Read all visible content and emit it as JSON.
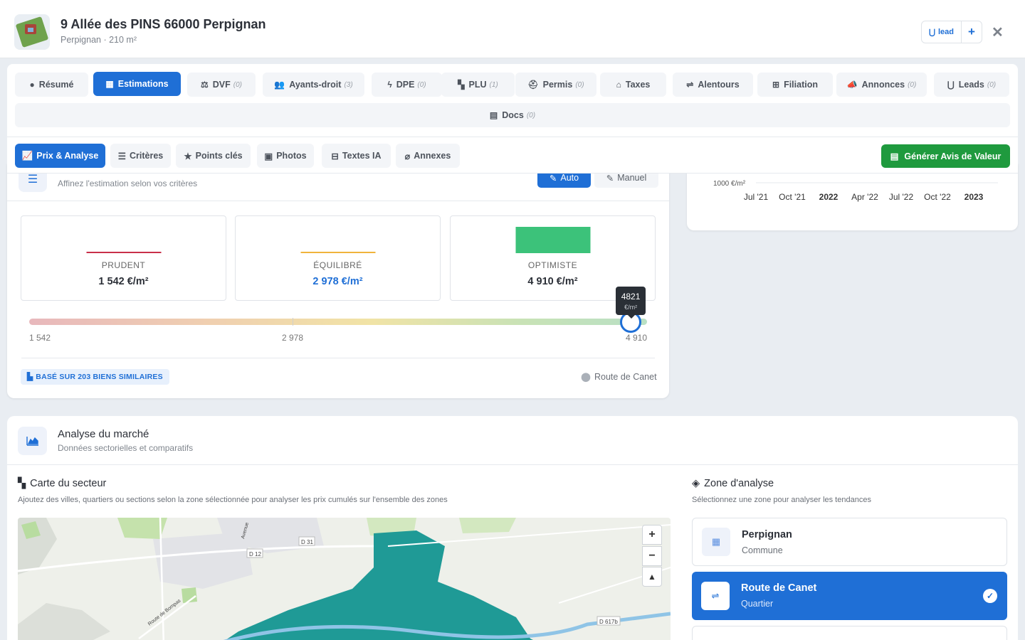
{
  "header": {
    "title": "9 Allée des PINS 66000 Perpignan",
    "subtitle": "Perpignan · 210 m²",
    "lead_label": "lead",
    "add_label": "+",
    "close_label": "✕"
  },
  "tabs": [
    {
      "label": "Résumé",
      "count": "",
      "icon": "info-circle"
    },
    {
      "label": "Estimations",
      "count": "",
      "icon": "calculator"
    },
    {
      "label": "DVF",
      "count": "(0)",
      "icon": "scale"
    },
    {
      "label": "Ayants-droit",
      "count": "(3)",
      "icon": "users"
    },
    {
      "label": "DPE",
      "count": "(0)",
      "icon": "bolt"
    },
    {
      "label": "PLU",
      "count": "(1)",
      "icon": "map-marked"
    },
    {
      "label": "Permis",
      "count": "(0)",
      "icon": "hard-hat"
    },
    {
      "label": "Taxes",
      "count": "",
      "icon": "landmark"
    },
    {
      "label": "Alentours",
      "count": "",
      "icon": "signs"
    },
    {
      "label": "Filiation",
      "count": "",
      "icon": "sitemap"
    },
    {
      "label": "Annonces",
      "count": "(0)",
      "icon": "bullhorn"
    },
    {
      "label": "Leads",
      "count": "(0)",
      "icon": "magnet"
    },
    {
      "label": "Docs",
      "count": "(0)",
      "icon": "file"
    }
  ],
  "active_tab": "Estimations",
  "subtabs": [
    {
      "label": "Prix & Analyse",
      "icon": "chart-line"
    },
    {
      "label": "Critères",
      "icon": "sliders"
    },
    {
      "label": "Points clés",
      "icon": "star"
    },
    {
      "label": "Photos",
      "icon": "images"
    },
    {
      "label": "Textes IA",
      "icon": "robot"
    },
    {
      "label": "Annexes",
      "icon": "paperclip"
    }
  ],
  "active_subtab": "Prix & Analyse",
  "generate_button": "Générer Avis de Valeur",
  "adjust": {
    "subtitle": "Affinez l'estimation selon vos critères",
    "mode_auto": "Auto",
    "mode_manual": "Manuel"
  },
  "scenarios": [
    {
      "label": "PRUDENT",
      "value": "1 542 €/m²",
      "color": "#c9304a"
    },
    {
      "label": "ÉQUILIBRÉ",
      "value": "2 978 €/m²",
      "color": "#f0b43c"
    },
    {
      "label": "OPTIMISTE",
      "value": "4 910 €/m²",
      "color": "#3cc27a"
    }
  ],
  "slider": {
    "min_label": "1 542",
    "mid_label": "2 978",
    "max_label": "4 910",
    "min": 1542,
    "max": 4910,
    "value": 4821,
    "tooltip_value": "4821",
    "tooltip_unit": "€/m²"
  },
  "based_on": "BASÉ SUR 203 BIENS SIMILAIRES",
  "location": "Route de Canet",
  "mini_chart": {
    "y_label": "1000 €/m²",
    "x_labels": [
      "Jul '21",
      "Oct '21",
      "2022",
      "Apr '22",
      "Jul '22",
      "Oct '22",
      "2023"
    ],
    "bold_labels": [
      "2022",
      "2023"
    ]
  },
  "market": {
    "title": "Analyse du marché",
    "subtitle": "Données sectorielles et comparatifs",
    "map_title": "Carte du secteur",
    "map_subtitle": "Ajoutez des villes, quartiers ou sections selon la zone sélectionnée pour analyser les prix cumulés sur l'ensemble des zones",
    "zone_title": "Zone d'analyse",
    "zone_subtitle": "Sélectionnez une zone pour analyser les tendances",
    "map_labels": [
      "D 12",
      "D 31",
      "D 617b",
      "Route de Bompas",
      "Avenue"
    ],
    "zoom_in": "+",
    "zoom_out": "−"
  },
  "zones": [
    {
      "name": "Perpignan",
      "type": "Commune",
      "selected": false
    },
    {
      "name": "Route de Canet",
      "type": "Quartier",
      "selected": true
    }
  ],
  "colors": {
    "primary": "#1f6fd6",
    "success": "#1f9a3e",
    "zone_fill": "#1f9a96"
  }
}
